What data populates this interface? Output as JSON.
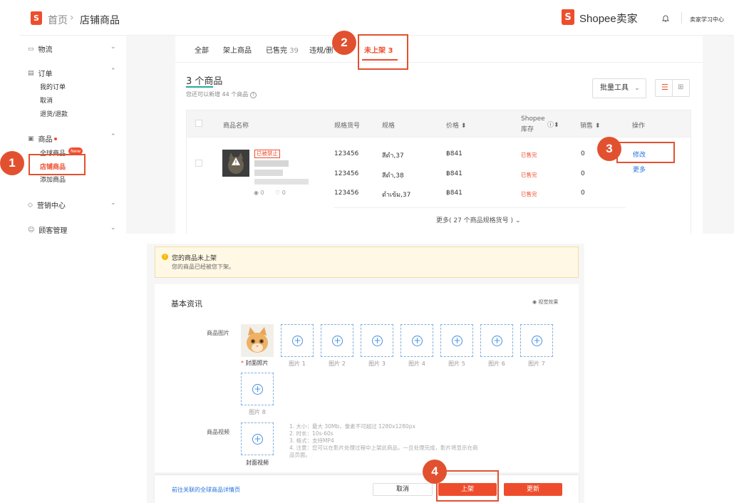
{
  "header": {
    "logo_letter": "S",
    "breadcrumb_home": "首页",
    "breadcrumb_sep": "›",
    "breadcrumb_current": "店铺商品",
    "brand_name": "Shopee卖家",
    "learning_center": "卖家学习中心"
  },
  "sidebar": {
    "logistics": "物流",
    "orders": "订单",
    "my_orders": "我的订单",
    "cancel": "取消",
    "returns": "退货/退款",
    "products": "商品",
    "global_products": "全球商品",
    "new_badge": "New",
    "shop_products": "店铺商品",
    "add_product": "添加商品",
    "marketing": "营销中心",
    "customer": "顾客管理"
  },
  "tabs": {
    "all": "全部",
    "live": "架上商品",
    "sold_out": "已售完",
    "sold_out_count": "39",
    "violation": "违规/删",
    "unlisted": "未上架 3"
  },
  "summary": {
    "count": "3 个商品",
    "remaining": "您还可以新增 44 个商品",
    "bulk_tools": "批量工具"
  },
  "table": {
    "headers": {
      "name": "商品名称",
      "sku": "规格货号",
      "variation": "规格",
      "price": "价格 ⬍",
      "stock_line1": "Shopee",
      "stock_line2": "库存",
      "sales": "销售 ⬍",
      "action": "操作"
    },
    "banned_tag": "已被禁止",
    "likes": "0",
    "views": "0",
    "rows": [
      {
        "sku": "123456",
        "variation": "สีดำ,37",
        "price": "฿841",
        "stock": "已售完",
        "sales": "0"
      },
      {
        "sku": "123456",
        "variation": "สีดำ,38",
        "price": "฿841",
        "stock": "已售完",
        "sales": "0"
      },
      {
        "sku": "123456",
        "variation": "ดำเข้ม,37",
        "price": "฿841",
        "stock": "已售完",
        "sales": "0"
      }
    ],
    "edit": "修改",
    "more": "更多",
    "more_variations": "更多( 27 个商品规格货号 )"
  },
  "callouts": [
    "1",
    "2",
    "3",
    "4"
  ],
  "notice": {
    "title": "您的商品未上架",
    "desc": "您的商品已经被您下架。"
  },
  "basic_info": {
    "title": "基本资讯",
    "preview": "视觉效果",
    "images_label": "商品图片",
    "cover_label": "封面照片",
    "image_slots": [
      "图片 1",
      "图片 2",
      "图片 3",
      "图片 4",
      "图片 5",
      "图片 6",
      "图片 7",
      "图片 8"
    ],
    "video_label": "商品视频",
    "video_cover_label": "封面视频",
    "video_rules": [
      "1. 大小：最大 30Mb，像素不可超过 1280x1280px",
      "2. 时长：10s-60s",
      "3. 格式：支持MP4",
      "4. 注意：您可以在影片处理过程中上架此商品，一旦处理完成，影片将显示在商",
      "品页面。"
    ]
  },
  "footer": {
    "link": "前往关联的全球商品详情页",
    "cancel": "取消",
    "publish": "上架",
    "update": "更新"
  },
  "colors": {
    "accent": "#ee4d2d",
    "callout": "#e2512f",
    "link": "#2673dd"
  }
}
